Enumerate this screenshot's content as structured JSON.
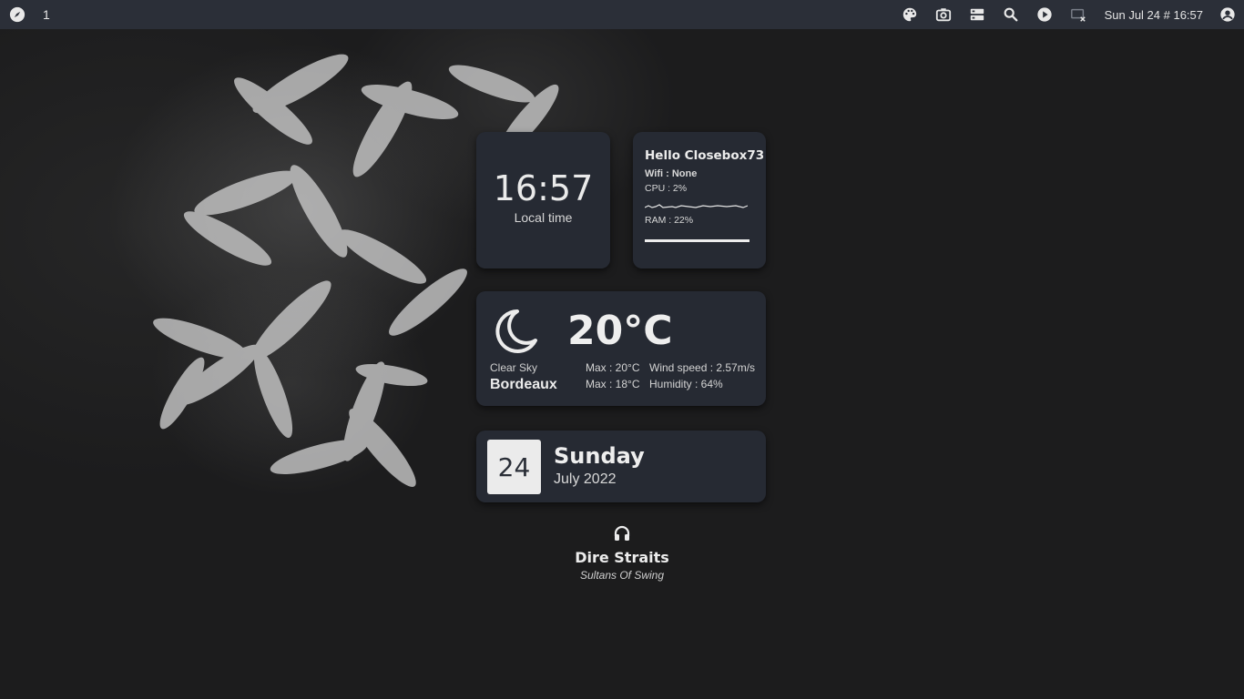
{
  "topbar": {
    "workspace": "1",
    "left_icon": "compass-icon",
    "right_icons": [
      "palette-icon",
      "camera-icon",
      "storage-icon",
      "search-icon",
      "play-icon",
      "screen-off-icon"
    ],
    "clock": "Sun Jul 24 # 16:57",
    "user_icon": "account-circle-icon"
  },
  "time_widget": {
    "time": "16:57",
    "label": "Local time"
  },
  "system_widget": {
    "greeting": "Hello Closebox73",
    "wifi": "Wifi :   None",
    "cpu": "CPU : 2%",
    "ram": "RAM : 22%",
    "ram_fraction": 0.22
  },
  "weather_widget": {
    "icon": "moon-icon",
    "temperature": "20°C",
    "condition": "Clear Sky",
    "city": "Bordeaux",
    "max": "Max : 20°C",
    "min": "Max : 18°C",
    "wind": "Wind speed : 2.57m/s",
    "humidity": "Humidity : 64%"
  },
  "date_widget": {
    "day": "24",
    "weekday": "Sunday",
    "month_year": "July 2022"
  },
  "music_widget": {
    "icon": "headphones-icon",
    "artist": "Dire Straits",
    "title": "Sultans Of Swing"
  },
  "colors": {
    "bar": "#2b2f38",
    "card": "#262a33",
    "background": "#1c1c1d",
    "accent": "#ebebeb"
  }
}
